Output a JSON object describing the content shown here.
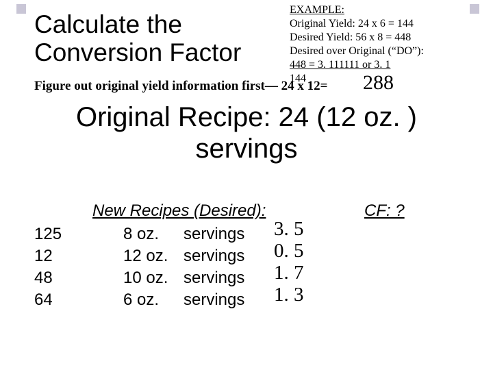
{
  "title": "Calculate the Conversion Factor",
  "example": {
    "heading": "EXAMPLE:",
    "line1": "Original Yield:  24 x 6  = 144",
    "line2": "Desired Yield:  56 x 8  = 448",
    "line3": "Desired over Original (“DO”):",
    "line4": "448    =  3. 111111 or 3. 1",
    "line5": "144"
  },
  "figure_line": "Figure out original yield information first— 24 x 12=",
  "figure_result": "288",
  "original_recipe_line1": "Original Recipe:  24  (12 oz. )",
  "original_recipe_line2": "servings",
  "new_recipes_header": "New Recipes (Desired):",
  "cf_header": "CF: ?",
  "rows": [
    {
      "count": "125",
      "size": "8 oz.",
      "serv": "servings",
      "cf": "3. 5"
    },
    {
      "count": "12",
      "size": "12 oz.",
      "serv": "servings",
      "cf": "0. 5"
    },
    {
      "count": "48",
      "size": "10 oz.",
      "serv": "servings",
      "cf": "1. 7"
    },
    {
      "count": "64",
      "size": "6 oz.",
      "serv": "servings",
      "cf": "1. 3"
    }
  ]
}
